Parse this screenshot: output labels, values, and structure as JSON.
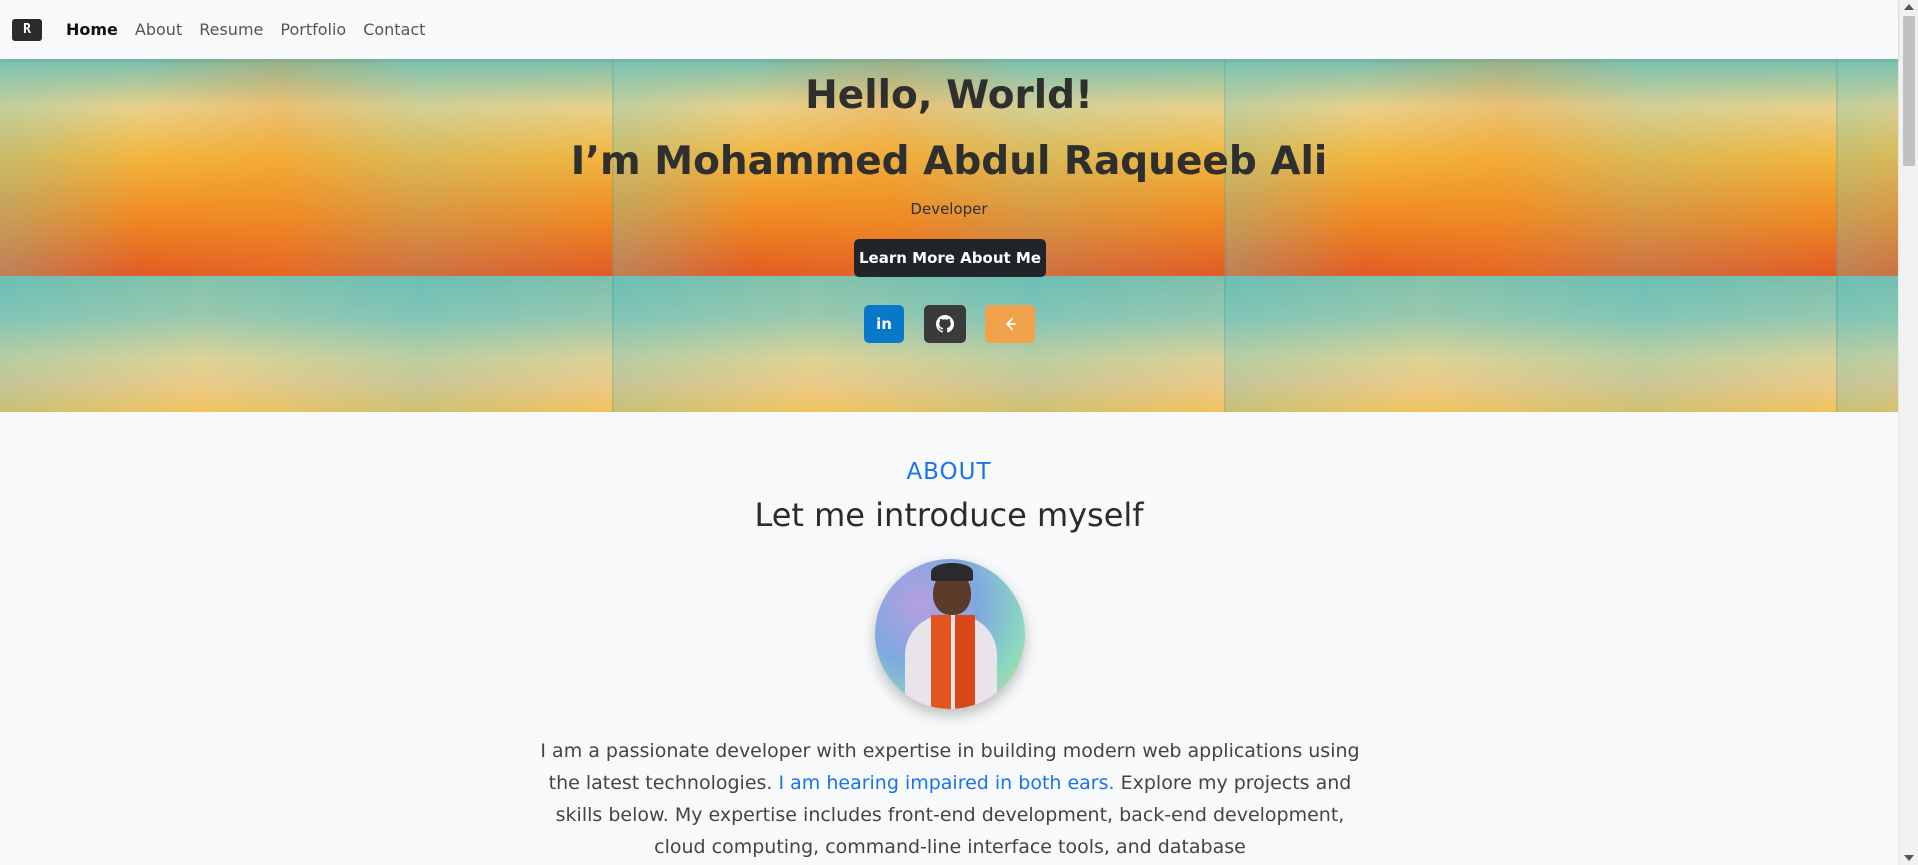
{
  "nav": {
    "brand_icon": "R",
    "items": [
      {
        "label": "Home",
        "active": true
      },
      {
        "label": "About",
        "active": false
      },
      {
        "label": "Resume",
        "active": false
      },
      {
        "label": "Portfolio",
        "active": false
      },
      {
        "label": "Contact",
        "active": false
      }
    ]
  },
  "hero": {
    "greeting": "Hello, World!",
    "name": "I’m Mohammed Abdul Raqueeb Ali",
    "role": "Developer",
    "cta_label": "Learn More About Me",
    "social": [
      {
        "icon": "linkedin-icon",
        "label": "in",
        "color": "#0a78c8"
      },
      {
        "icon": "github-icon",
        "label": "",
        "color": "#3a3a3a"
      },
      {
        "icon": "leetcode-icon",
        "label": "",
        "color": "#f1a14a"
      }
    ]
  },
  "about": {
    "kicker": "ABOUT",
    "title": "Let me introduce myself",
    "text_before": "I am a passionate developer with expertise in building modern web applications using the latest technologies. ",
    "text_highlight": "I am hearing impaired in both ears.",
    "text_after": " Explore my projects and skills below. My expertise includes front-end development, back-end development, cloud computing, command-line interface tools, and database"
  },
  "colors": {
    "accent": "#1a73e8",
    "dark": "#212529"
  }
}
